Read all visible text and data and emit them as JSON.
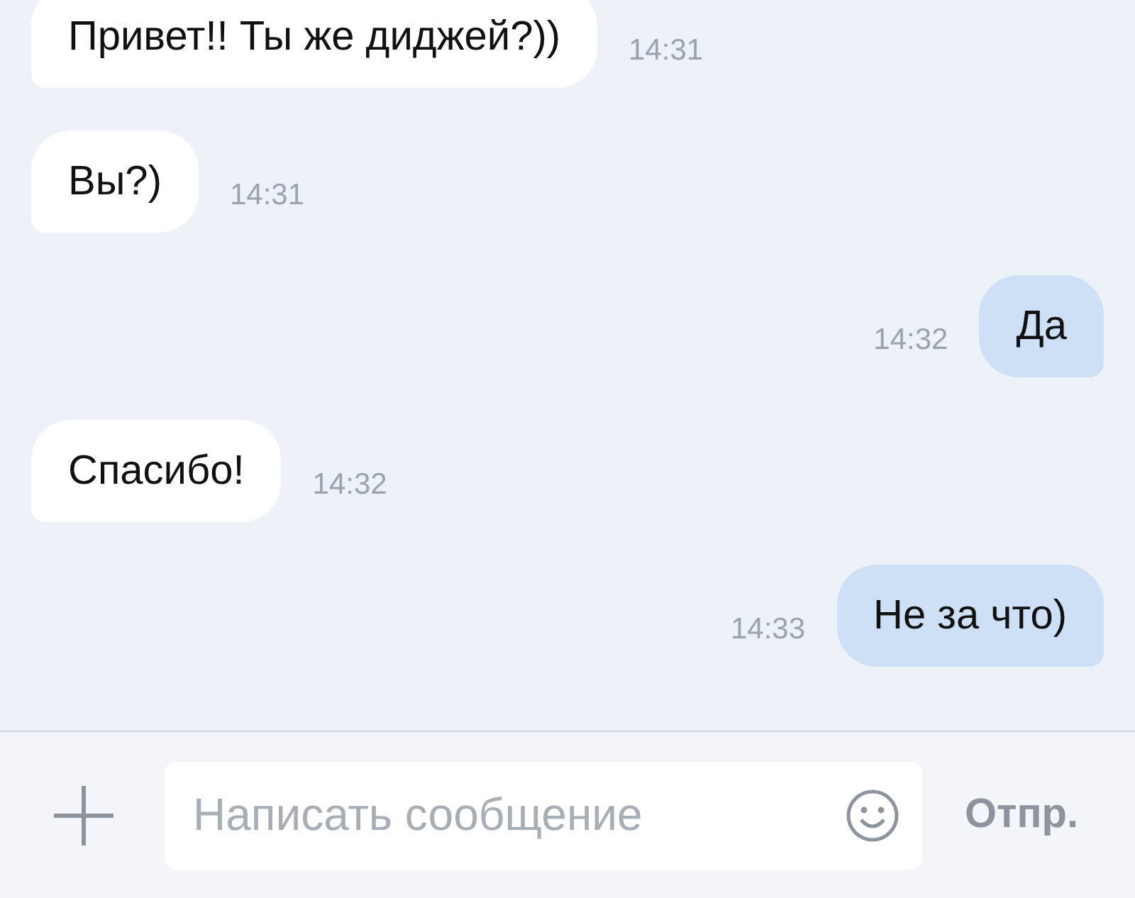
{
  "messages": [
    {
      "kind": "incoming",
      "text": "Привет!! Ты же диджей?))",
      "time": "14:31"
    },
    {
      "kind": "incoming",
      "text": "Вы?)",
      "time": "14:31"
    },
    {
      "kind": "outgoing",
      "text": "Да",
      "time": "14:32"
    },
    {
      "kind": "incoming",
      "text": "Спасибо!",
      "time": "14:32"
    },
    {
      "kind": "outgoing",
      "text": "Не за что)",
      "time": "14:33"
    }
  ],
  "composer": {
    "placeholder": "Написать сообщение",
    "send": "Отпр."
  }
}
